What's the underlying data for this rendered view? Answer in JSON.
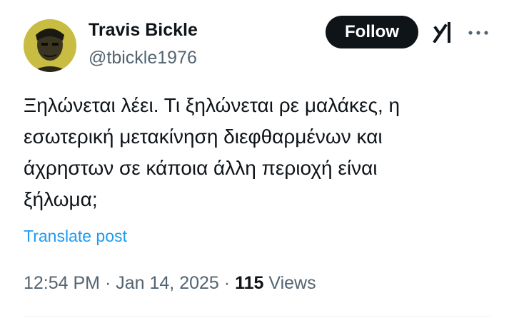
{
  "author": {
    "display_name": "Travis Bickle",
    "handle": "@tbickle1976",
    "avatar_icon": "avatar-photo"
  },
  "actions": {
    "follow_label": "Follow",
    "grok_icon": "grok-icon",
    "more_icon": "more-dots-icon"
  },
  "post": {
    "text": "Ξηλώνεται λέει. Τι ξηλώνεται ρε μαλάκες, η\nεσωτερική μετακίνηση διεφθαρμένων και\nάχρηστων σε κάποια άλλη περιοχή είναι\nξήλωμα;",
    "translate_label": "Translate post"
  },
  "meta": {
    "time": "12:54 PM",
    "separator": "·",
    "date": "Jan 14, 2025",
    "views_count": "115",
    "views_label": "Views"
  },
  "colors": {
    "accent": "#1d9bf0",
    "text_primary": "#0f1419",
    "text_secondary": "#536471",
    "follow_bg": "#0f1419",
    "avatar_bg": "#c6b83e"
  }
}
